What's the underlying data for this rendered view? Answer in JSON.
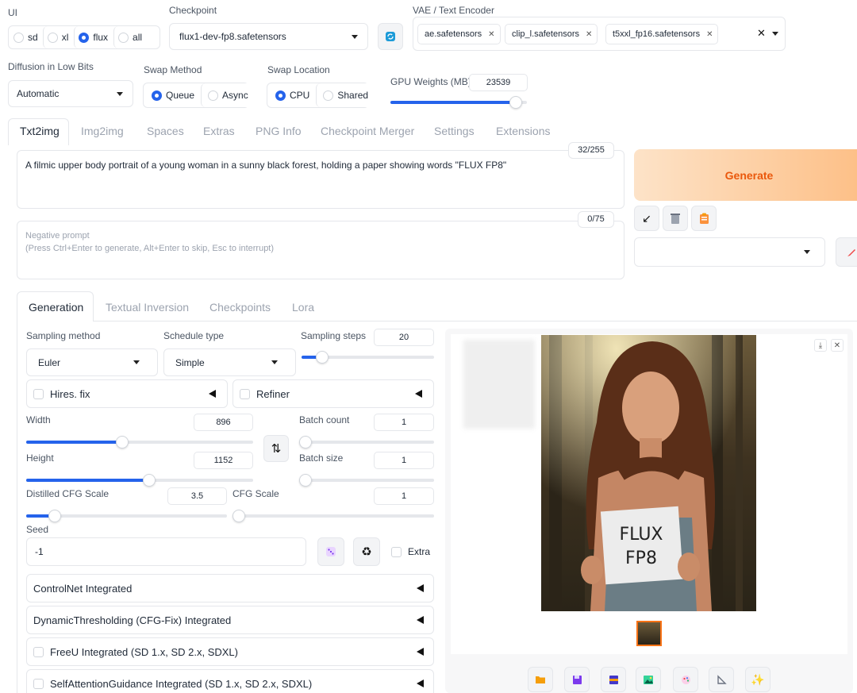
{
  "top": {
    "ui_label": "UI",
    "ui_options": [
      {
        "label": "sd",
        "selected": false
      },
      {
        "label": "xl",
        "selected": false
      },
      {
        "label": "flux",
        "selected": true
      },
      {
        "label": "all",
        "selected": false
      }
    ],
    "checkpoint_label": "Checkpoint",
    "checkpoint_value": "flux1-dev-fp8.safetensors",
    "vae_label": "VAE / Text Encoder",
    "vae_chips": [
      "ae.safetensors",
      "clip_l.safetensors",
      "t5xxl_fp16.safetensors"
    ],
    "diffusion_label": "Diffusion in Low Bits",
    "diffusion_value": "Automatic",
    "swap_method_label": "Swap Method",
    "swap_method_options": [
      {
        "label": "Queue",
        "selected": true
      },
      {
        "label": "Async",
        "selected": false
      }
    ],
    "swap_location_label": "Swap Location",
    "swap_location_options": [
      {
        "label": "CPU",
        "selected": true
      },
      {
        "label": "Shared",
        "selected": false
      }
    ],
    "gpu_weights_label": "GPU Weights (MB)",
    "gpu_weights_value": "23539"
  },
  "main_tabs": [
    "Txt2img",
    "Img2img",
    "Spaces",
    "Extras",
    "PNG Info",
    "Checkpoint Merger",
    "Settings",
    "Extensions"
  ],
  "prompt": {
    "text": "A filmic upper body portrait of a young woman in a sunny black forest,  holding a paper showing words \"FLUX FP8\"",
    "token_count": "32/255",
    "negative_placeholder": "Negative prompt\n(Press Ctrl+Enter to generate, Alt+Enter to skip, Esc to interrupt)",
    "negative_token_count": "0/75"
  },
  "generate_label": "Generate",
  "sub_tabs": [
    "Generation",
    "Textual Inversion",
    "Checkpoints",
    "Lora"
  ],
  "generation": {
    "sampling_method_label": "Sampling method",
    "sampling_method_value": "Euler",
    "schedule_type_label": "Schedule type",
    "schedule_type_value": "Simple",
    "sampling_steps_label": "Sampling steps",
    "sampling_steps_value": "20",
    "sampling_steps_fraction": 0.19,
    "hires_label": "Hires. fix",
    "refiner_label": "Refiner",
    "width_label": "Width",
    "width_value": "896",
    "width_fraction": 0.43,
    "height_label": "Height",
    "height_value": "1152",
    "height_fraction": 0.55,
    "batch_count_label": "Batch count",
    "batch_count_value": "1",
    "batch_size_label": "Batch size",
    "batch_size_value": "1",
    "distilled_cfg_label": "Distilled CFG Scale",
    "distilled_cfg_value": "3.5",
    "distilled_cfg_fraction": 0.13,
    "cfg_scale_label": "CFG Scale",
    "cfg_scale_value": "1",
    "seed_label": "Seed",
    "seed_value": "-1",
    "extra_label": "Extra"
  },
  "accordions": [
    {
      "label": "ControlNet Integrated",
      "checkbox": false
    },
    {
      "label": "DynamicThresholding (CFG-Fix) Integrated",
      "checkbox": false
    },
    {
      "label": "FreeU Integrated (SD 1.x, SD 2.x, SDXL)",
      "checkbox": true
    },
    {
      "label": "SelfAttentionGuidance Integrated (SD 1.x, SD 2.x, SDXL)",
      "checkbox": true
    }
  ],
  "output_image": {
    "sign_line1": "FLUX",
    "sign_line2": "FP8"
  },
  "colors": {
    "accent": "#2563eb",
    "generate_text": "#ea580c",
    "generate_bg_start": "#fed7aa",
    "generate_bg_end": "#fdba74"
  }
}
